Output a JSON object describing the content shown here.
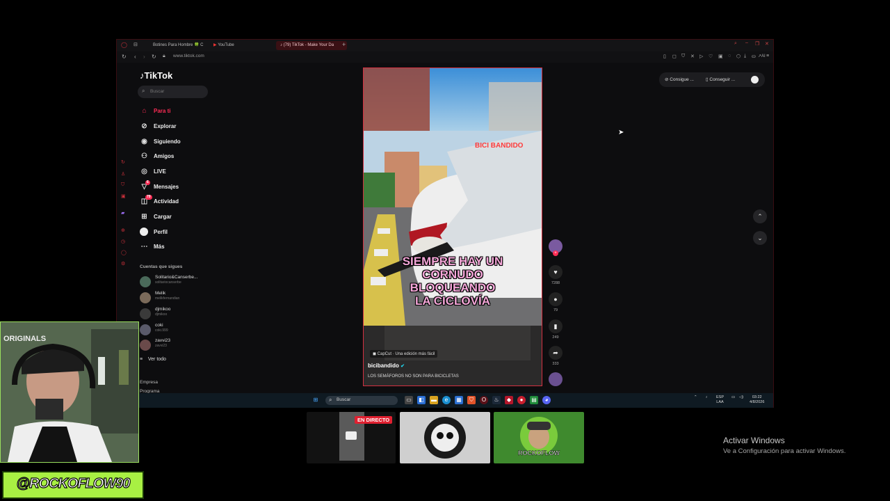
{
  "browser": {
    "tabs": [
      {
        "label": "Botines Para Hombre 🍀 C"
      },
      {
        "label": "YouTube"
      },
      {
        "label": "(79) TikTok - Make Your Da"
      }
    ],
    "url": "www.tiktok.com"
  },
  "tiktok": {
    "logo": "TikTok",
    "search_placeholder": "Buscar",
    "nav": [
      {
        "label": "Para ti",
        "icon": "home-icon",
        "badge": ""
      },
      {
        "label": "Explorar",
        "icon": "compass-icon",
        "badge": ""
      },
      {
        "label": "Siguiendo",
        "icon": "following-icon",
        "badge": ""
      },
      {
        "label": "Amigos",
        "icon": "friends-icon",
        "badge": ""
      },
      {
        "label": "LIVE",
        "icon": "live-icon",
        "badge": ""
      },
      {
        "label": "Mensajes",
        "icon": "messages-icon",
        "badge": "6"
      },
      {
        "label": "Actividad",
        "icon": "activity-icon",
        "badge": "79"
      },
      {
        "label": "Cargar",
        "icon": "upload-icon",
        "badge": ""
      },
      {
        "label": "Perfil",
        "icon": "profile-icon",
        "badge": ""
      },
      {
        "label": "Más",
        "icon": "more-icon",
        "badge": ""
      }
    ],
    "following_header": "Cuentas que sigues",
    "following": [
      {
        "name": "Solitario&Canserbe...",
        "handle": "solitariocanserbe"
      },
      {
        "name": "Melik",
        "handle": "melikfernandian"
      },
      {
        "name": "djmikoo",
        "handle": "djmikoo"
      },
      {
        "name": "coki",
        "handle": "coki.999"
      },
      {
        "name": "zavvi23",
        "handle": "zavvi23"
      }
    ],
    "see_all": "Ver todo",
    "footer": [
      "Empresa",
      "Programa"
    ],
    "top_controls": {
      "btn1": "Consigue ...",
      "btn2": "Conseguir ..."
    },
    "video": {
      "sticker": "BICI BANDIDO",
      "caption_lines": [
        "SIEMPRE HAY UN",
        "CORNUDO",
        "BLOQUEANDO",
        "LA CICLOVÍA"
      ],
      "capcut": "CapCut · Una edición más fácil",
      "author": "bicibandido",
      "description": "LOS SEMÁFOROS NO SON PARA BICICLETAS"
    },
    "actions": {
      "likes": "7288",
      "comments": "79",
      "saves": "249",
      "shares": "333"
    }
  },
  "taskbar": {
    "search": "Buscar",
    "lang_top": "ESP",
    "lang_bottom": "LAA",
    "time": "03:22",
    "date": "4/8/2026"
  },
  "stream": {
    "overlay_text": "ORIGINALS",
    "handle": "@ROCKOFLOW90",
    "live_badge": "EN DIRECTO",
    "thumb_logo": "ROCKOFLOW"
  },
  "windows_activation": {
    "title": "Activar Windows",
    "subtitle": "Ve a Configuración para activar Windows."
  }
}
